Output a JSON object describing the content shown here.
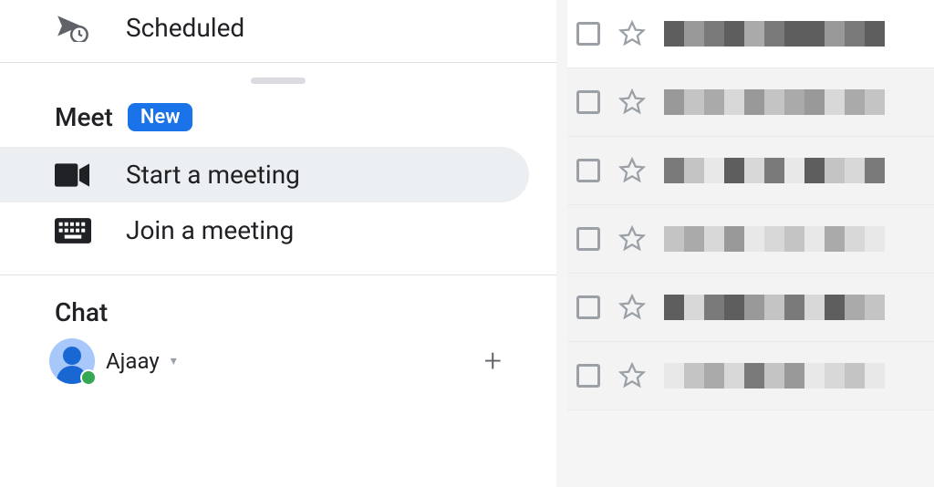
{
  "sidebar": {
    "scheduled_label": "Scheduled",
    "meet": {
      "title": "Meet",
      "badge": "New",
      "start_label": "Start a meeting",
      "join_label": "Join a meeting"
    },
    "chat": {
      "title": "Chat",
      "user_name": "Ajaay"
    }
  }
}
